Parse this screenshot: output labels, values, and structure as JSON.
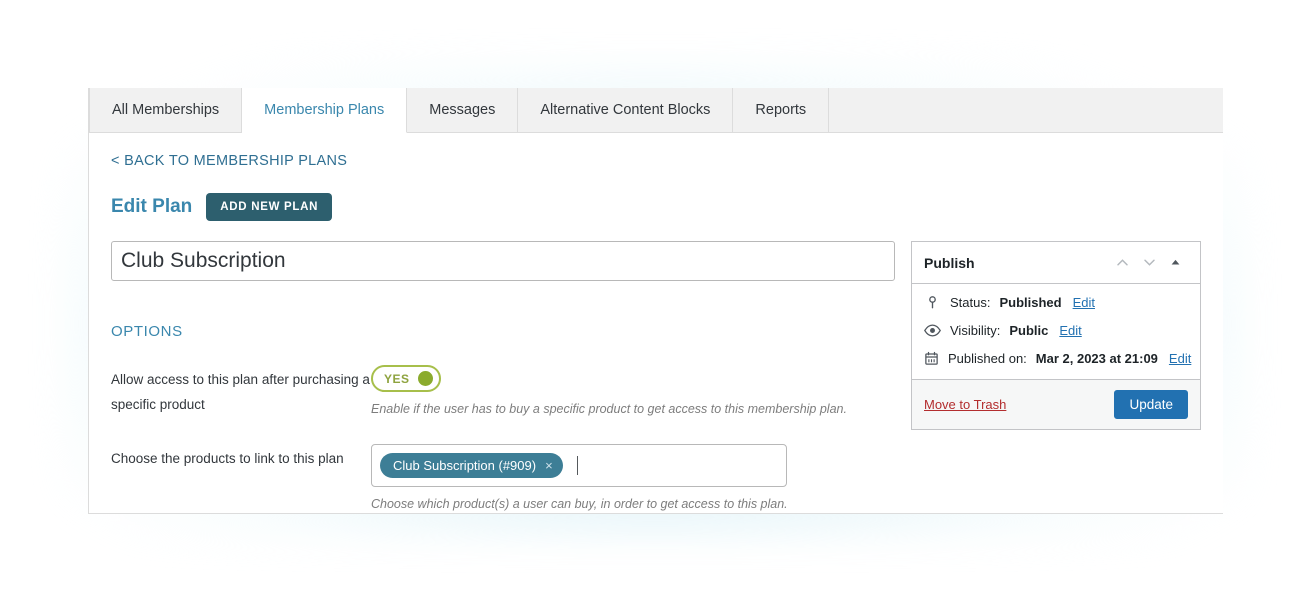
{
  "tabs": [
    {
      "label": "All Memberships",
      "active": false
    },
    {
      "label": "Membership Plans",
      "active": true
    },
    {
      "label": "Messages",
      "active": false
    },
    {
      "label": "Alternative Content Blocks",
      "active": false
    },
    {
      "label": "Reports",
      "active": false
    }
  ],
  "back_link": "< BACK TO MEMBERSHIP PLANS",
  "heading": "Edit Plan",
  "add_new_button": "ADD NEW PLAN",
  "title_field": {
    "value": "Club Subscription",
    "placeholder": "Enter plan name"
  },
  "options_heading": "OPTIONS",
  "fields": {
    "allow_access": {
      "label": "Allow access to this plan after purchasing a specific product",
      "toggle_label": "YES",
      "help": "Enable if the user has to buy a specific product to get access to this membership plan."
    },
    "link_products": {
      "label": "Choose the products to link to this plan",
      "chip_label": "Club Subscription (#909)",
      "chip_remove": "×",
      "help": "Choose which product(s) a user can buy, in order to get access to this plan."
    }
  },
  "publish": {
    "title": "Publish",
    "rows": [
      {
        "icon": "pin-icon",
        "prefix": "Status: ",
        "value": "Published",
        "edit": "Edit"
      },
      {
        "icon": "eye-icon",
        "prefix": "Visibility: ",
        "value": "Public",
        "edit": "Edit"
      },
      {
        "icon": "calendar-icon",
        "prefix": "Published on: ",
        "value": "Mar 2, 2023 at 21:09",
        "edit": "Edit"
      }
    ],
    "trash_label": "Move to Trash",
    "update_label": "Update"
  },
  "colors": {
    "accent_teal": "#3a87ad",
    "button_dark_teal": "#2d5f6e",
    "chip_blue": "#3d7e96",
    "wp_blue": "#2271b1",
    "trash_red": "#b32d2e",
    "toggle_green": "#8bab2d"
  }
}
